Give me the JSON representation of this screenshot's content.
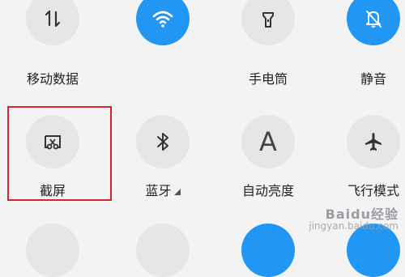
{
  "tiles": {
    "mobile_data": {
      "label": "移动数据",
      "icon": "mobile-data-icon",
      "active": false
    },
    "wifi": {
      "label": "",
      "icon": "wifi-icon",
      "active": true
    },
    "flashlight": {
      "label": "手电筒",
      "icon": "flashlight-icon",
      "active": false
    },
    "silent": {
      "label": "静音",
      "icon": "bell-off-icon",
      "active": true
    },
    "screenshot": {
      "label": "截屏",
      "icon": "screenshot-icon",
      "active": false
    },
    "bluetooth": {
      "label": "蓝牙",
      "icon": "bluetooth-icon",
      "active": false
    },
    "auto_brightness": {
      "label": "自动亮度",
      "icon": "letter-a-icon",
      "glyph": "A",
      "active": false
    },
    "airplane": {
      "label": "飞行模式",
      "icon": "airplane-icon",
      "active": false
    }
  },
  "colors": {
    "active": "#2196f3",
    "inactive": "#e6e6e6",
    "highlight": "#d8232a",
    "background": "#f3f3f3"
  },
  "watermark": {
    "brand": "Baidu经验",
    "url": "jingyan.baidu.com"
  }
}
